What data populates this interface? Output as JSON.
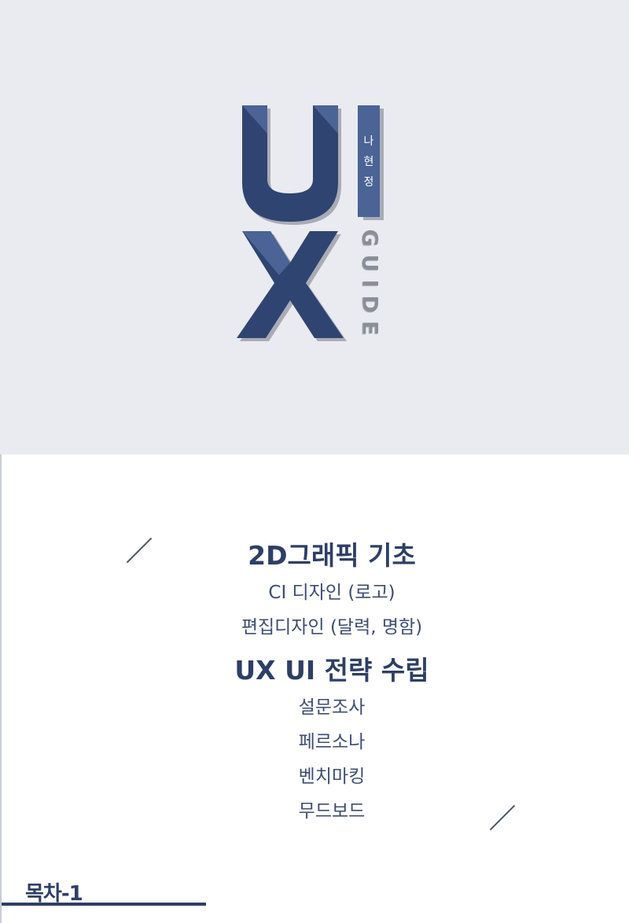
{
  "cover": {
    "logo_letters": [
      "U",
      "I",
      "X"
    ],
    "author_chars": [
      "나",
      "현",
      "정"
    ],
    "guide_text": "GUIDE",
    "colors": {
      "background": "#e9ebf1",
      "navy": "#2f4471",
      "navy_light": "#4b6395",
      "shadow": "#a9acb5"
    }
  },
  "toc": {
    "sections": [
      {
        "heading": "2D그래픽 기초",
        "items": [
          "CI 디자인 (로고)",
          "편집디자인 (달력, 명함)"
        ]
      },
      {
        "heading": "UX UI 전략 수립",
        "items": [
          "설문조사",
          "페르소나",
          "벤치마킹",
          "무드보드"
        ]
      }
    ],
    "label": "목차-1",
    "colors": {
      "text": "#2e3f66",
      "divider": "#4b5563"
    }
  }
}
